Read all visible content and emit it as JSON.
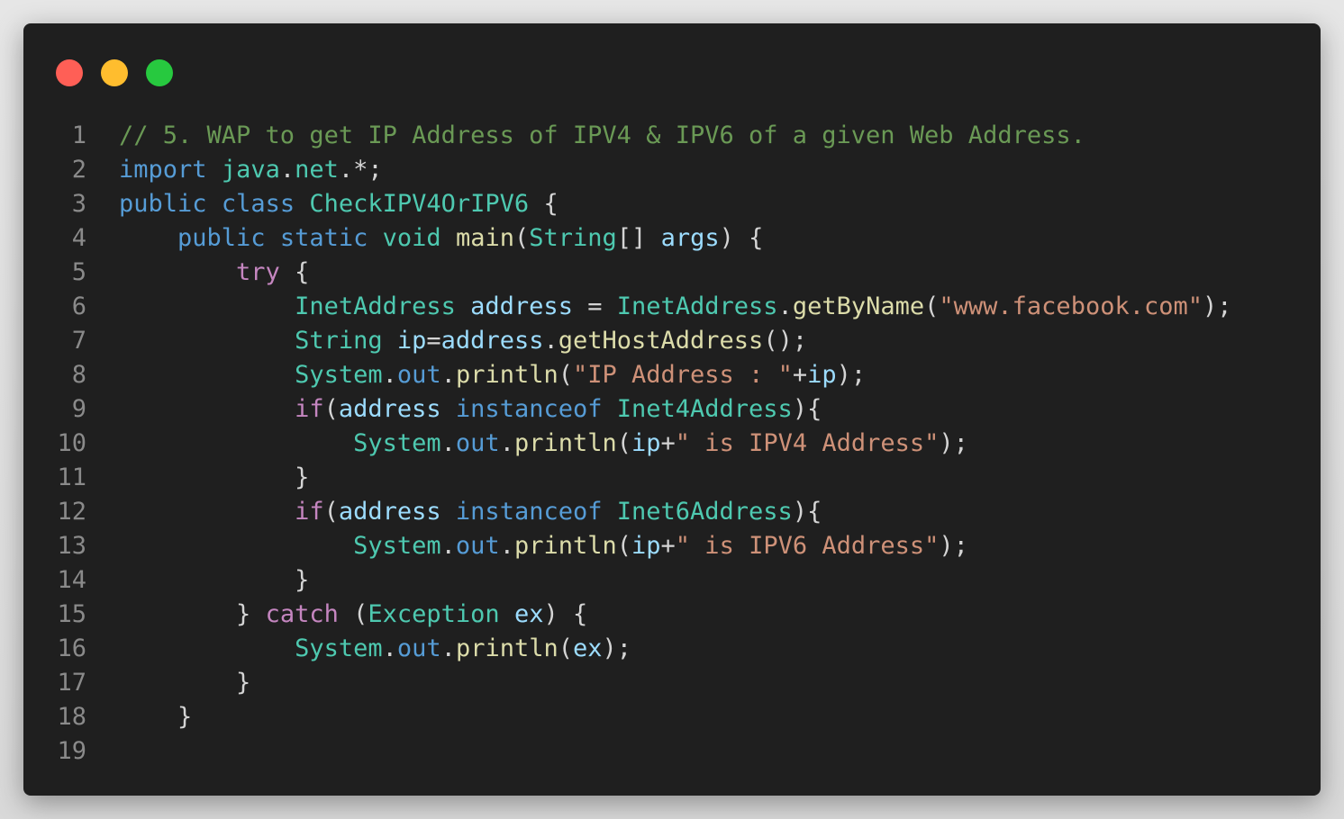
{
  "window": {
    "controls": [
      {
        "name": "close",
        "color": "#ff5f56"
      },
      {
        "name": "minimize",
        "color": "#ffbd2e"
      },
      {
        "name": "maximize",
        "color": "#27c93f"
      }
    ]
  },
  "code": {
    "lines": [
      {
        "num": "1",
        "tokens": [
          {
            "t": "// 5. WAP to get IP Address of IPV4 & IPV6 of a given Web Address.",
            "k": "comment"
          }
        ]
      },
      {
        "num": "2",
        "tokens": [
          {
            "t": "import",
            "k": "keyword"
          },
          {
            "t": " ",
            "k": "plain"
          },
          {
            "t": "java",
            "k": "type"
          },
          {
            "t": ".",
            "k": "punct"
          },
          {
            "t": "net",
            "k": "type"
          },
          {
            "t": ".*;",
            "k": "punct"
          }
        ]
      },
      {
        "num": "3",
        "tokens": [
          {
            "t": "public",
            "k": "keyword"
          },
          {
            "t": " ",
            "k": "plain"
          },
          {
            "t": "class",
            "k": "keyword"
          },
          {
            "t": " ",
            "k": "plain"
          },
          {
            "t": "CheckIPV4OrIPV6",
            "k": "type"
          },
          {
            "t": " {",
            "k": "punct"
          }
        ]
      },
      {
        "num": "4",
        "tokens": [
          {
            "t": "    ",
            "k": "plain"
          },
          {
            "t": "public",
            "k": "keyword"
          },
          {
            "t": " ",
            "k": "plain"
          },
          {
            "t": "static",
            "k": "keyword"
          },
          {
            "t": " ",
            "k": "plain"
          },
          {
            "t": "void",
            "k": "type"
          },
          {
            "t": " ",
            "k": "plain"
          },
          {
            "t": "main",
            "k": "func"
          },
          {
            "t": "(",
            "k": "punct"
          },
          {
            "t": "String",
            "k": "type"
          },
          {
            "t": "[] ",
            "k": "punct"
          },
          {
            "t": "args",
            "k": "var"
          },
          {
            "t": ") {",
            "k": "punct"
          }
        ]
      },
      {
        "num": "5",
        "tokens": [
          {
            "t": "        ",
            "k": "plain"
          },
          {
            "t": "try",
            "k": "control"
          },
          {
            "t": " {",
            "k": "punct"
          }
        ]
      },
      {
        "num": "6",
        "tokens": [
          {
            "t": "            ",
            "k": "plain"
          },
          {
            "t": "InetAddress",
            "k": "type"
          },
          {
            "t": " ",
            "k": "plain"
          },
          {
            "t": "address",
            "k": "var"
          },
          {
            "t": " = ",
            "k": "punct"
          },
          {
            "t": "InetAddress",
            "k": "type"
          },
          {
            "t": ".",
            "k": "punct"
          },
          {
            "t": "getByName",
            "k": "func"
          },
          {
            "t": "(",
            "k": "punct"
          },
          {
            "t": "\"www.facebook.com\"",
            "k": "string"
          },
          {
            "t": ");",
            "k": "punct"
          }
        ]
      },
      {
        "num": "7",
        "tokens": [
          {
            "t": "            ",
            "k": "plain"
          },
          {
            "t": "String",
            "k": "type"
          },
          {
            "t": " ",
            "k": "plain"
          },
          {
            "t": "ip",
            "k": "var"
          },
          {
            "t": "=",
            "k": "punct"
          },
          {
            "t": "address",
            "k": "var"
          },
          {
            "t": ".",
            "k": "punct"
          },
          {
            "t": "getHostAddress",
            "k": "func"
          },
          {
            "t": "();",
            "k": "punct"
          }
        ]
      },
      {
        "num": "8",
        "tokens": [
          {
            "t": "            ",
            "k": "plain"
          },
          {
            "t": "System",
            "k": "type"
          },
          {
            "t": ".",
            "k": "punct"
          },
          {
            "t": "out",
            "k": "keyword"
          },
          {
            "t": ".",
            "k": "punct"
          },
          {
            "t": "println",
            "k": "func"
          },
          {
            "t": "(",
            "k": "punct"
          },
          {
            "t": "\"IP Address : \"",
            "k": "string"
          },
          {
            "t": "+",
            "k": "punct"
          },
          {
            "t": "ip",
            "k": "var"
          },
          {
            "t": ");",
            "k": "punct"
          }
        ]
      },
      {
        "num": "9",
        "tokens": [
          {
            "t": "            ",
            "k": "plain"
          },
          {
            "t": "if",
            "k": "control"
          },
          {
            "t": "(",
            "k": "punct"
          },
          {
            "t": "address",
            "k": "var"
          },
          {
            "t": " ",
            "k": "plain"
          },
          {
            "t": "instanceof",
            "k": "keyword"
          },
          {
            "t": " ",
            "k": "plain"
          },
          {
            "t": "Inet4Address",
            "k": "type"
          },
          {
            "t": "){",
            "k": "punct"
          }
        ]
      },
      {
        "num": "10",
        "tokens": [
          {
            "t": "                ",
            "k": "plain"
          },
          {
            "t": "System",
            "k": "type"
          },
          {
            "t": ".",
            "k": "punct"
          },
          {
            "t": "out",
            "k": "keyword"
          },
          {
            "t": ".",
            "k": "punct"
          },
          {
            "t": "println",
            "k": "func"
          },
          {
            "t": "(",
            "k": "punct"
          },
          {
            "t": "ip",
            "k": "var"
          },
          {
            "t": "+",
            "k": "punct"
          },
          {
            "t": "\" is IPV4 Address\"",
            "k": "string"
          },
          {
            "t": ");",
            "k": "punct"
          }
        ]
      },
      {
        "num": "11",
        "tokens": [
          {
            "t": "            ",
            "k": "plain"
          },
          {
            "t": "}",
            "k": "punct"
          }
        ]
      },
      {
        "num": "12",
        "tokens": [
          {
            "t": "            ",
            "k": "plain"
          },
          {
            "t": "if",
            "k": "control"
          },
          {
            "t": "(",
            "k": "punct"
          },
          {
            "t": "address",
            "k": "var"
          },
          {
            "t": " ",
            "k": "plain"
          },
          {
            "t": "instanceof",
            "k": "keyword"
          },
          {
            "t": " ",
            "k": "plain"
          },
          {
            "t": "Inet6Address",
            "k": "type"
          },
          {
            "t": "){",
            "k": "punct"
          }
        ]
      },
      {
        "num": "13",
        "tokens": [
          {
            "t": "                ",
            "k": "plain"
          },
          {
            "t": "System",
            "k": "type"
          },
          {
            "t": ".",
            "k": "punct"
          },
          {
            "t": "out",
            "k": "keyword"
          },
          {
            "t": ".",
            "k": "punct"
          },
          {
            "t": "println",
            "k": "func"
          },
          {
            "t": "(",
            "k": "punct"
          },
          {
            "t": "ip",
            "k": "var"
          },
          {
            "t": "+",
            "k": "punct"
          },
          {
            "t": "\" is IPV6 Address\"",
            "k": "string"
          },
          {
            "t": ");",
            "k": "punct"
          }
        ]
      },
      {
        "num": "14",
        "tokens": [
          {
            "t": "            ",
            "k": "plain"
          },
          {
            "t": "}",
            "k": "punct"
          }
        ]
      },
      {
        "num": "15",
        "tokens": [
          {
            "t": "        ",
            "k": "plain"
          },
          {
            "t": "} ",
            "k": "punct"
          },
          {
            "t": "catch",
            "k": "control"
          },
          {
            "t": " (",
            "k": "punct"
          },
          {
            "t": "Exception",
            "k": "type"
          },
          {
            "t": " ",
            "k": "plain"
          },
          {
            "t": "ex",
            "k": "var"
          },
          {
            "t": ") {",
            "k": "punct"
          }
        ]
      },
      {
        "num": "16",
        "tokens": [
          {
            "t": "            ",
            "k": "plain"
          },
          {
            "t": "System",
            "k": "type"
          },
          {
            "t": ".",
            "k": "punct"
          },
          {
            "t": "out",
            "k": "keyword"
          },
          {
            "t": ".",
            "k": "punct"
          },
          {
            "t": "println",
            "k": "func"
          },
          {
            "t": "(",
            "k": "punct"
          },
          {
            "t": "ex",
            "k": "var"
          },
          {
            "t": ");",
            "k": "punct"
          }
        ]
      },
      {
        "num": "17",
        "tokens": [
          {
            "t": "        ",
            "k": "plain"
          },
          {
            "t": "}",
            "k": "punct"
          }
        ]
      },
      {
        "num": "18",
        "tokens": [
          {
            "t": "    ",
            "k": "plain"
          },
          {
            "t": "}",
            "k": "punct"
          }
        ]
      },
      {
        "num": "19",
        "tokens": []
      }
    ]
  }
}
